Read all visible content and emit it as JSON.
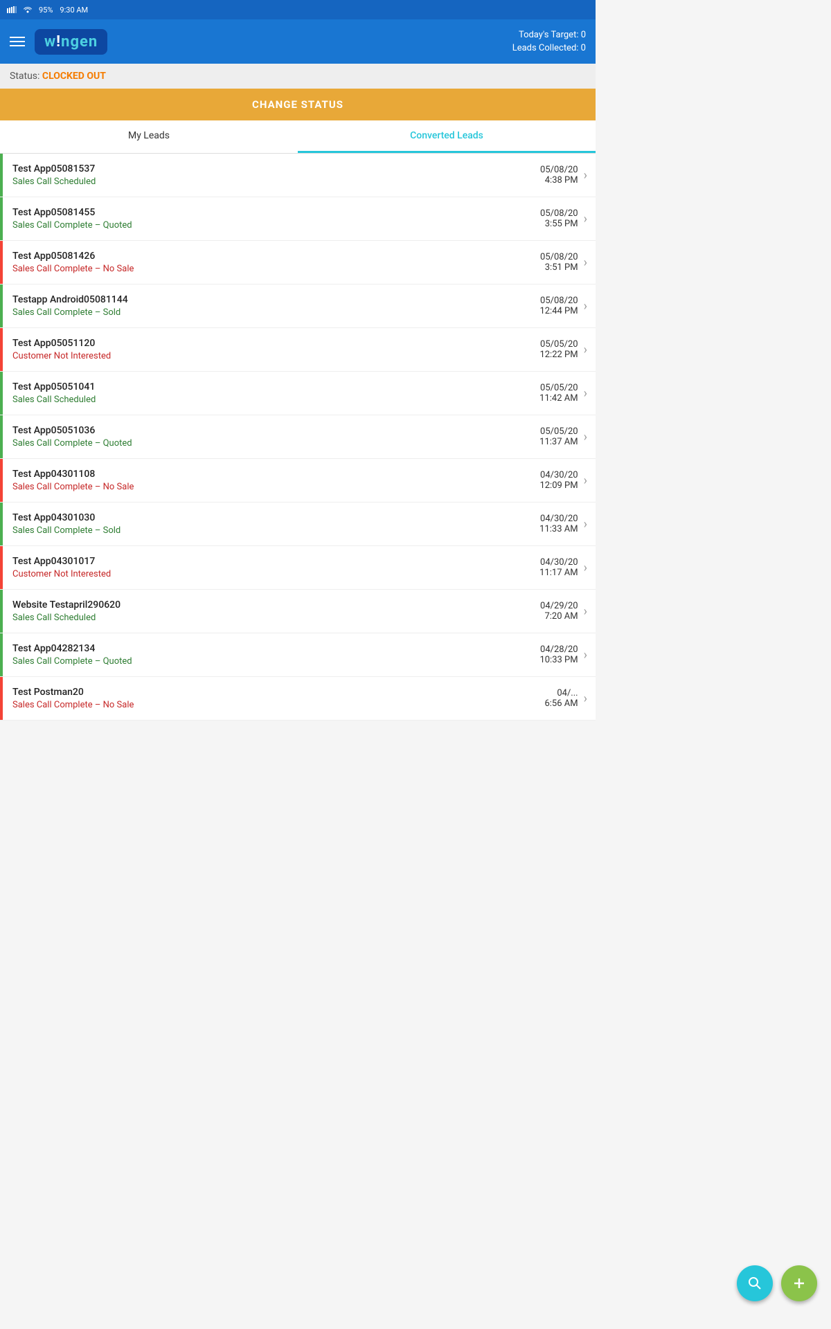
{
  "statusBar": {
    "battery": "95%",
    "time": "9:30 AM"
  },
  "header": {
    "logo": "w!ngen",
    "todaysTarget": "Today's Target: 0",
    "leadsCollected": "Leads Collected: 0"
  },
  "statusBanner": {
    "label": "Status:",
    "value": "CLOCKED OUT"
  },
  "changeStatusBtn": "CHANGE STATUS",
  "tabs": [
    {
      "id": "my-leads",
      "label": "My Leads",
      "active": false
    },
    {
      "id": "converted-leads",
      "label": "Converted Leads",
      "active": true
    }
  ],
  "leads": [
    {
      "name": "Test App05081537",
      "status": "Sales Call Scheduled",
      "statusType": "green",
      "borderType": "green",
      "date": "05/08/20",
      "time": "4:38 PM"
    },
    {
      "name": "Test App05081455",
      "status": "Sales Call Complete – Quoted",
      "statusType": "green",
      "borderType": "green",
      "date": "05/08/20",
      "time": "3:55 PM"
    },
    {
      "name": "Test App05081426",
      "status": "Sales Call Complete – No Sale",
      "statusType": "red",
      "borderType": "red",
      "date": "05/08/20",
      "time": "3:51 PM"
    },
    {
      "name": "Testapp Android05081144",
      "status": "Sales Call Complete – Sold",
      "statusType": "green",
      "borderType": "green",
      "date": "05/08/20",
      "time": "12:44 PM"
    },
    {
      "name": "Test App05051120",
      "status": "Customer Not Interested",
      "statusType": "red",
      "borderType": "red",
      "date": "05/05/20",
      "time": "12:22 PM"
    },
    {
      "name": "Test App05051041",
      "status": "Sales Call Scheduled",
      "statusType": "green",
      "borderType": "green",
      "date": "05/05/20",
      "time": "11:42 AM"
    },
    {
      "name": "Test App05051036",
      "status": "Sales Call Complete – Quoted",
      "statusType": "green",
      "borderType": "green",
      "date": "05/05/20",
      "time": "11:37 AM"
    },
    {
      "name": "Test App04301108",
      "status": "Sales Call Complete – No Sale",
      "statusType": "red",
      "borderType": "red",
      "date": "04/30/20",
      "time": "12:09 PM"
    },
    {
      "name": "Test App04301030",
      "status": "Sales Call Complete – Sold",
      "statusType": "green",
      "borderType": "green",
      "date": "04/30/20",
      "time": "11:33 AM"
    },
    {
      "name": "Test App04301017",
      "status": "Customer Not Interested",
      "statusType": "red",
      "borderType": "red",
      "date": "04/30/20",
      "time": "11:17 AM"
    },
    {
      "name": "Website Testapril290620",
      "status": "Sales Call Scheduled",
      "statusType": "green",
      "borderType": "green",
      "date": "04/29/20",
      "time": "7:20 AM"
    },
    {
      "name": "Test App04282134",
      "status": "Sales Call Complete – Quoted",
      "statusType": "green",
      "borderType": "green",
      "date": "04/28/20",
      "time": "10:33 PM"
    },
    {
      "name": "Test Postman20",
      "status": "Sales Call Complete – No Sale",
      "statusType": "red",
      "borderType": "red",
      "date": "04/...",
      "time": "6:56 AM"
    }
  ],
  "fabs": {
    "search": "🔍",
    "add": "+"
  }
}
